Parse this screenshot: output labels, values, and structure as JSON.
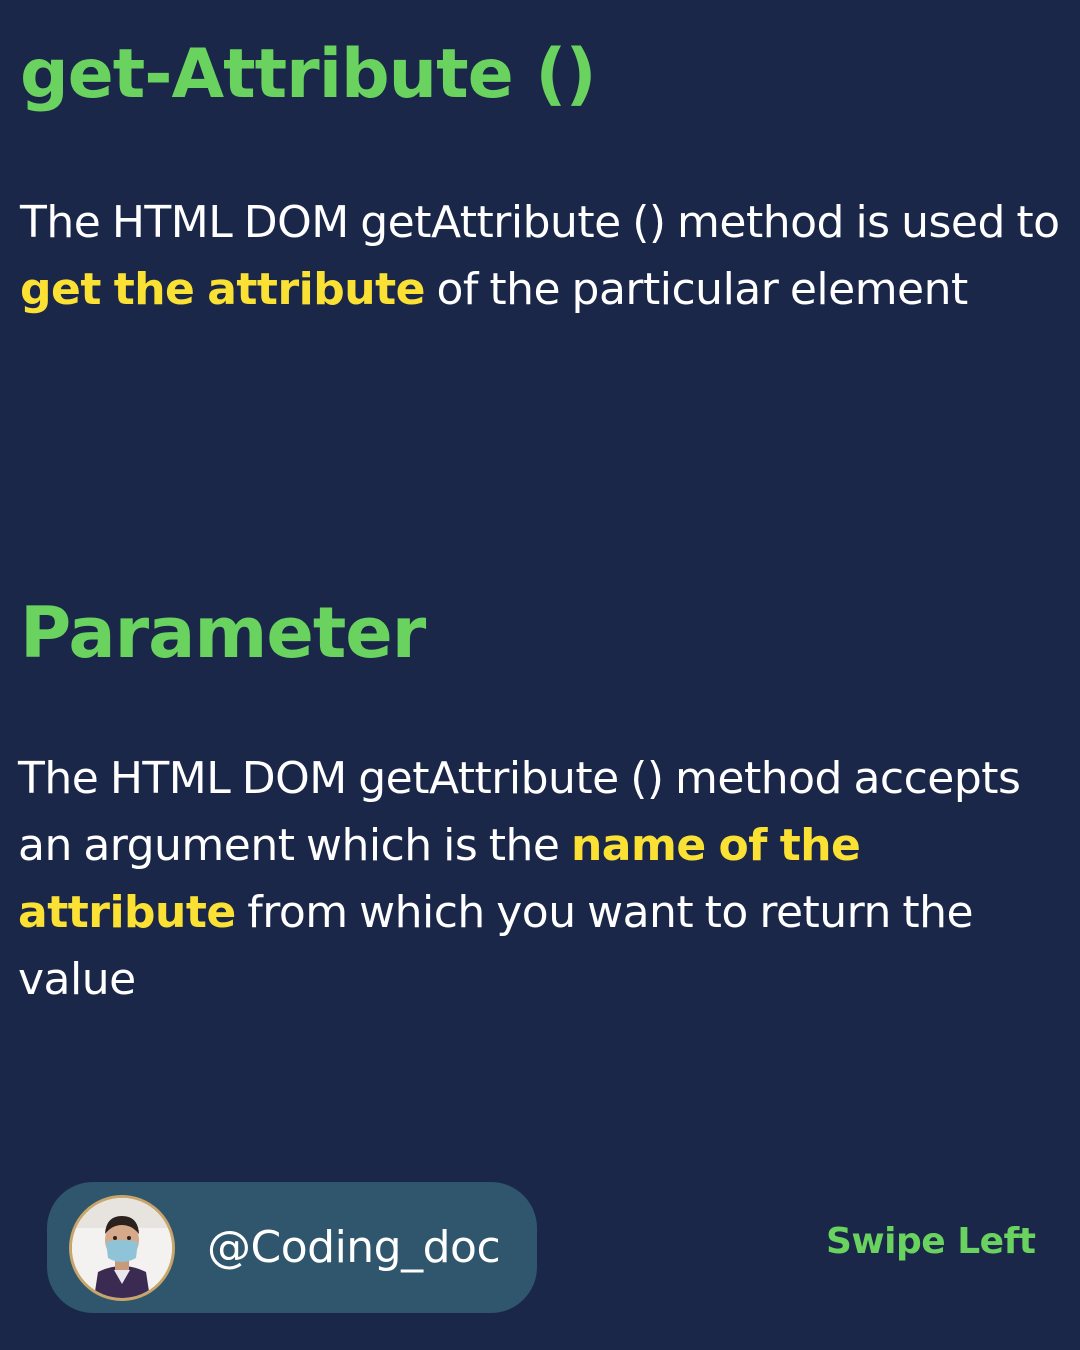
{
  "title": "get-Attribute ()",
  "paragraph1": {
    "before": "The HTML DOM getAttribute () method is used to ",
    "highlight": "get the attribute",
    "after": " of the particular element"
  },
  "section_title": "Parameter",
  "paragraph2": {
    "before": "The HTML DOM getAttribute () method accepts an argument which is the ",
    "highlight": "name of the attribute",
    "after": " from which you want to return the value"
  },
  "author": {
    "handle": "@Coding_doc",
    "avatar_icon": "profile-photo"
  },
  "swipe_label": "Swipe Left",
  "colors": {
    "background": "#1b2749",
    "heading": "#6ad360",
    "highlight": "#fbe133",
    "pill": "#2f566d",
    "text": "#ffffff"
  }
}
